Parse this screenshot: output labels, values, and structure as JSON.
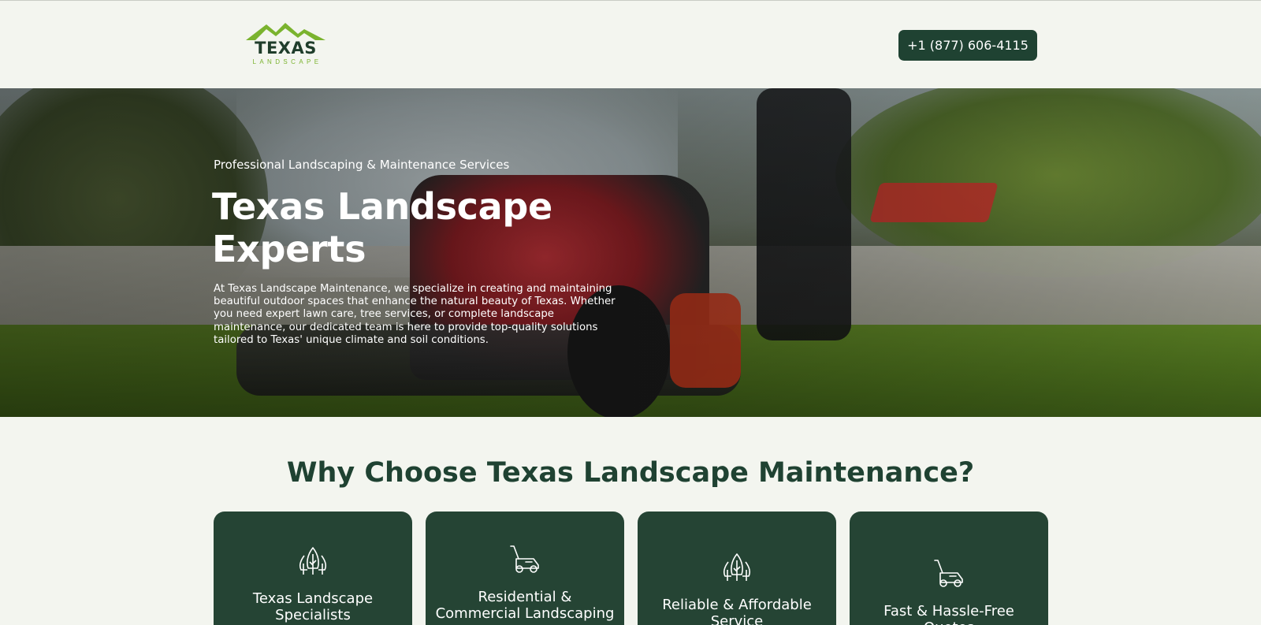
{
  "header": {
    "logo_main": "TEXAS",
    "logo_sub": "LANDSCAPE",
    "phone_label": "+1 (877) 606-4115"
  },
  "hero": {
    "kicker": "Professional Landscaping & Maintenance Services",
    "title": "Texas Landscape Experts",
    "text": "At Texas Landscape Maintenance, we specialize in creating and maintaining beautiful outdoor spaces that enhance the natural beauty of Texas. Whether you need expert lawn care, tree services, or complete landscape maintenance, our dedicated team is here to provide top-quality solutions tailored to Texas' unique climate and soil conditions."
  },
  "why": {
    "title": "Why Choose Texas Landscape Maintenance?",
    "cards": [
      {
        "title": "Texas Landscape Specialists",
        "icon": "trees-icon"
      },
      {
        "title": "Residential & Commercial Landscaping",
        "icon": "lawn-mower-icon"
      },
      {
        "title": "Reliable & Affordable Service",
        "icon": "trees-icon"
      },
      {
        "title": "Fast & Hassle-Free Quotes",
        "icon": "lawn-mower-icon"
      }
    ]
  },
  "colors": {
    "brand_dark": "#1f4232",
    "card_bg": "#254434",
    "accent_green": "#7ab32e",
    "page_bg": "#f3f5ef"
  }
}
